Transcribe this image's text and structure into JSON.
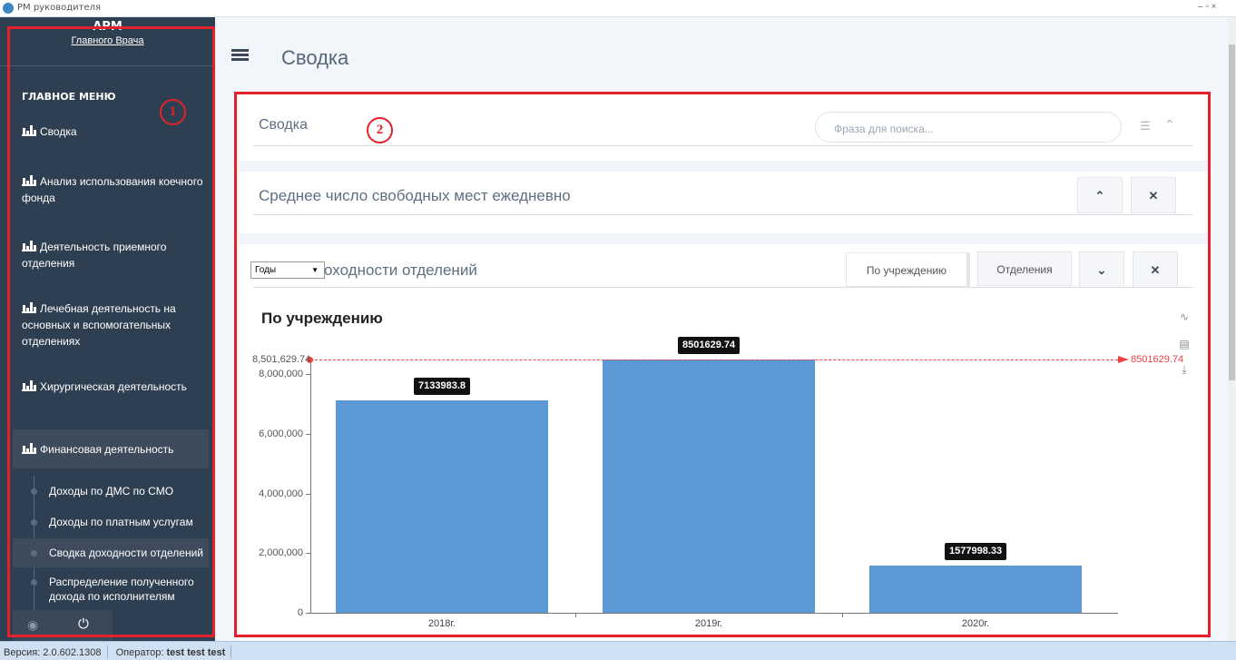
{
  "window": {
    "title": "РМ руководителя",
    "controls": "–  ▫  ×"
  },
  "sidebar": {
    "header_title": "АРМ",
    "header_subtitle": "Главного Врача",
    "main_menu": "ГЛАВНОЕ МЕНЮ",
    "items": [
      {
        "label": "Сводка"
      },
      {
        "label": "Анализ использования коечного фонда"
      },
      {
        "label": "Деятельность приемного отделения"
      },
      {
        "label": "Лечебная деятельность на основных и вспомогательных отделениях"
      },
      {
        "label": "Хирургическая деятельность"
      },
      {
        "label": "Финансовая деятельность"
      }
    ],
    "subitems": [
      {
        "label": "Доходы по ДМС по СМО"
      },
      {
        "label": "Доходы по платным услугам"
      },
      {
        "label": "Сводка доходности отделений"
      },
      {
        "label": "Распределение полученного дохода по исполнителям"
      }
    ]
  },
  "annotations": {
    "one": "1",
    "two": "2"
  },
  "header": {
    "title": "Сводка"
  },
  "panels": {
    "summary": {
      "title": "Сводка",
      "search_placeholder": "Фраза для поиска..."
    },
    "free_beds": {
      "title": "Среднее число свободных мест ежедневно"
    },
    "income": {
      "title": "Сводка доходности отделений",
      "period_select": "Годы",
      "tabs": [
        "По учреждению",
        "Отделения"
      ]
    }
  },
  "chart_data": {
    "type": "bar",
    "title": "По учреждению",
    "categories": [
      "2018г.",
      "2019г.",
      "2020г."
    ],
    "values": [
      7133983.8,
      8501629.74,
      1577998.33
    ],
    "data_labels": [
      "7133983.8",
      "8501629.74",
      "1577998.33"
    ],
    "y_ticks": [
      0,
      2000000,
      4000000,
      6000000,
      8000000
    ],
    "y_tick_labels": [
      "0",
      "2,000,000",
      "4,000,000",
      "6,000,000",
      "8,000,000"
    ],
    "ylim": [
      0,
      8501629.74
    ],
    "max_line": {
      "value": 8501629.74,
      "left_label": "8,501,629.74",
      "right_label": "8501629.74",
      "color": "#f04040"
    },
    "bar_color": "#5b99d6",
    "grid": false,
    "legend": "none"
  },
  "status": {
    "version_label": "Версия: 2.0.602.1308",
    "operator_label": "Оператор:",
    "operator_name": "test test test"
  }
}
